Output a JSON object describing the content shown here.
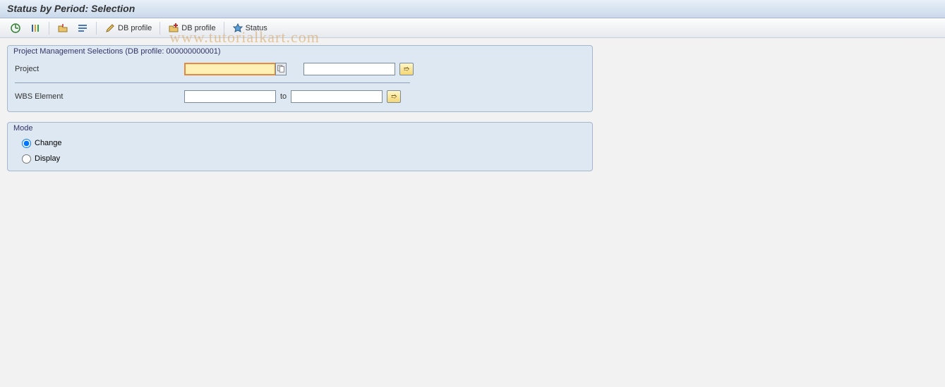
{
  "title": "Status by Period: Selection",
  "watermark": "www.tutorialkart.com",
  "toolbar": {
    "db_profile_edit": "DB profile",
    "db_profile_create": "DB profile",
    "status": "Status"
  },
  "group1": {
    "title": "Project Management Selections (DB profile: 000000000001)",
    "project_label": "Project",
    "project_from": "",
    "project_to": "",
    "wbs_label": "WBS Element",
    "wbs_to_label": "to",
    "wbs_from": "",
    "wbs_to": ""
  },
  "group2": {
    "title": "Mode",
    "change": "Change",
    "display": "Display",
    "selected": "change"
  }
}
